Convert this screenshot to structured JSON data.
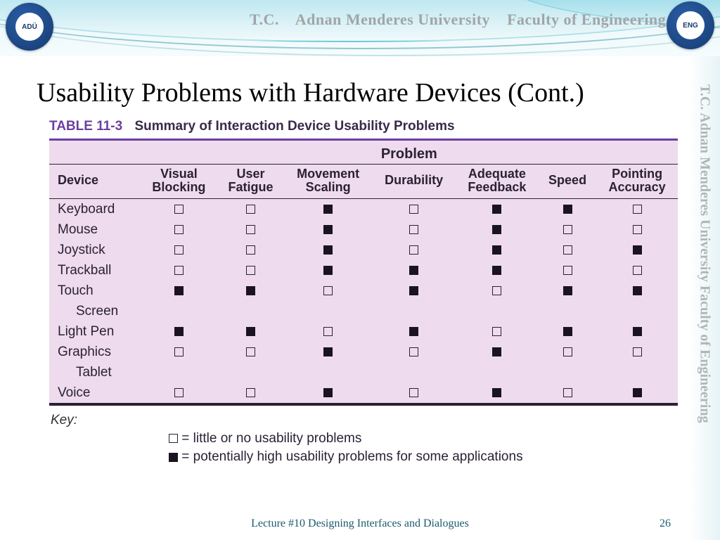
{
  "banner": {
    "org_short": "T.C.",
    "org": "Adnan Menderes University",
    "faculty": "Faculty of Engineering",
    "logo_left_text": "ADÜ",
    "logo_right_text": "ENG"
  },
  "sidebar_text": "T.C.   Adnan Menderes University   Faculty of Engineering",
  "slide_title": "Usability Problems with Hardware Devices (Cont.)",
  "table": {
    "number": "TABLE 11-3",
    "title": "Summary of Interaction Device Usability Problems",
    "superheader": "Problem",
    "device_header": "Device",
    "columns": [
      "Visual Blocking",
      "User Fatigue",
      "Movement Scaling",
      "Durability",
      "Adequate Feedback",
      "Speed",
      "Pointing Accuracy"
    ],
    "rows": [
      {
        "device": "Keyboard",
        "cells": [
          "empty",
          "empty",
          "filled",
          "empty",
          "filled",
          "filled",
          "empty"
        ]
      },
      {
        "device": "Mouse",
        "cells": [
          "empty",
          "empty",
          "filled",
          "empty",
          "filled",
          "empty",
          "empty"
        ]
      },
      {
        "device": "Joystick",
        "cells": [
          "empty",
          "empty",
          "filled",
          "empty",
          "filled",
          "empty",
          "filled"
        ]
      },
      {
        "device": "Trackball",
        "cells": [
          "empty",
          "empty",
          "filled",
          "filled",
          "filled",
          "empty",
          "empty"
        ]
      },
      {
        "device": "Touch Screen",
        "cells": [
          "filled",
          "filled",
          "empty",
          "filled",
          "empty",
          "filled",
          "filled"
        ],
        "wrap": true,
        "first": "Touch",
        "second": "Screen"
      },
      {
        "device": "Light Pen",
        "cells": [
          "filled",
          "filled",
          "empty",
          "filled",
          "empty",
          "filled",
          "filled"
        ]
      },
      {
        "device": "Graphics Tablet",
        "cells": [
          "empty",
          "empty",
          "filled",
          "empty",
          "filled",
          "empty",
          "empty"
        ],
        "wrap": true,
        "first": "Graphics",
        "second": "Tablet"
      },
      {
        "device": "Voice",
        "cells": [
          "empty",
          "empty",
          "filled",
          "empty",
          "filled",
          "empty",
          "filled"
        ]
      }
    ]
  },
  "key": {
    "label": "Key:",
    "empty_text": "= little or no usability problems",
    "filled_text": "= potentially high usability problems for some applications"
  },
  "footer": {
    "title": "Lecture #10 Designing Interfaces and Dialogues",
    "page": "26"
  }
}
